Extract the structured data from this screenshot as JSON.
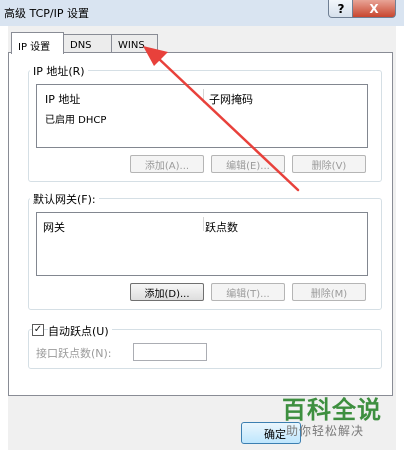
{
  "window": {
    "title": "高级 TCP/IP 设置",
    "help_label": "?",
    "close_label": "X"
  },
  "tabs": [
    {
      "label": "IP 设置",
      "active": true
    },
    {
      "label": "DNS",
      "active": false
    },
    {
      "label": "WINS",
      "active": false
    }
  ],
  "ip_address_group": {
    "label": "IP 地址(R)",
    "columns": [
      "IP 地址",
      "子网掩码"
    ],
    "rows": [
      [
        "已启用 DHCP",
        ""
      ]
    ],
    "buttons": [
      {
        "label": "添加(A)...",
        "enabled": false
      },
      {
        "label": "编辑(E)...",
        "enabled": false
      },
      {
        "label": "删除(V)",
        "enabled": false
      }
    ]
  },
  "gateway_group": {
    "label": "默认网关(F):",
    "columns": [
      "网关",
      "跃点数"
    ],
    "rows": [],
    "buttons": [
      {
        "label": "添加(D)...",
        "enabled": true
      },
      {
        "label": "编辑(T)...",
        "enabled": false
      },
      {
        "label": "删除(M)",
        "enabled": false
      }
    ]
  },
  "metric": {
    "auto_label": "自动跃点(U)",
    "auto_checked": true,
    "interface_label": "接口跃点数(N):",
    "interface_value": ""
  },
  "footer": {
    "ok_label": "确定"
  },
  "watermark": {
    "title": "百科全说",
    "subtitle": "助你轻松解决"
  },
  "annotation": {
    "arrow_color": "#e8413b"
  }
}
